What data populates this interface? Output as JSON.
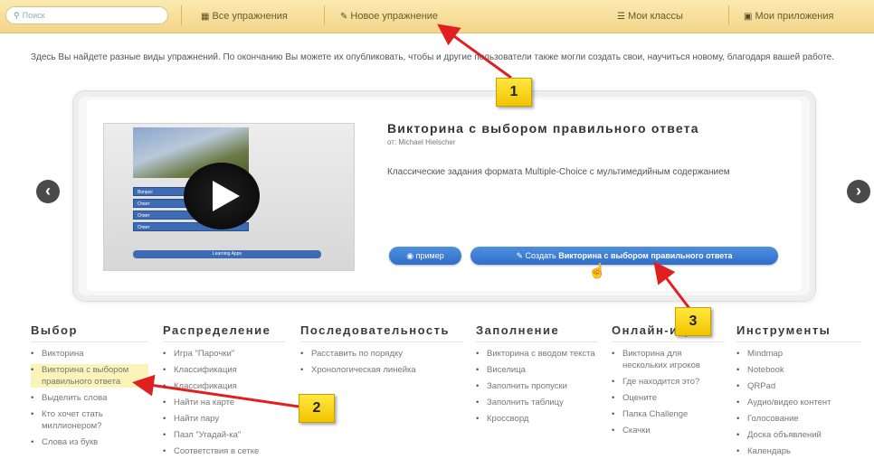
{
  "topbar": {
    "search_placeholder": "Поиск",
    "nav_all": "Все упражнения",
    "nav_new": "Новое упражнение",
    "nav_classes": "Мои классы",
    "nav_apps": "Мои приложения"
  },
  "intro": "Здесь Вы найдете разные виды упражнений. По окончанию Вы можете их опубликовать, чтобы и другие пользователи также могли создать свои, научиться новому, благодаря вашей работе.",
  "featured": {
    "title": "Викторина с выбором правильного ответа",
    "author": "от: Michael Hielscher",
    "description": "Классические задания формата Multiple-Choice с мультимедийным содержанием",
    "example_button": "пример",
    "create_prefix": "Создать",
    "create_name": "Викторина с выбором правильного ответа",
    "preview_options": [
      "Вопрос",
      "Ответ",
      "Ответ",
      "Ответ"
    ],
    "preview_bar": "Learning Apps"
  },
  "categories": [
    {
      "title": "Выбор",
      "items": [
        "Викторина",
        "Викторина с выбором правильного ответа",
        "Выделить слова",
        "Кто хочет стать миллионером?",
        "Слова из букв"
      ]
    },
    {
      "title": "Распределение",
      "items": [
        "Игра \"Парочки\"",
        "Классификация",
        "Классификация",
        "Найти на карте",
        "Найти пару",
        "Пазл \"Угадай-ка\"",
        "Соответствия в сетке"
      ]
    },
    {
      "title": "Последовательность",
      "items": [
        "Расставить по порядку",
        "Хронологическая линейка"
      ]
    },
    {
      "title": "Заполнение",
      "items": [
        "Викторина с вводом текста",
        "Виселица",
        "Заполнить пропуски",
        "Заполнить таблицу",
        "Кроссворд"
      ]
    },
    {
      "title": "Онлайн-игры",
      "items": [
        "Викторина для нескольких игроков",
        "Где находится это?",
        "Оцените",
        "Папка Challenge",
        "Скачки"
      ]
    },
    {
      "title": "Инструменты",
      "items": [
        "Mindmap",
        "Notebook",
        "QRPad",
        "Аудио/видео контент",
        "Голосование",
        "Доска объявлений",
        "Календарь"
      ]
    }
  ],
  "callouts": [
    "1",
    "2",
    "3"
  ],
  "colors": {
    "accent": "#2f6fc8",
    "topbar": "#f3d58a",
    "callout": "#f2c400",
    "arrow": "#e02020"
  }
}
